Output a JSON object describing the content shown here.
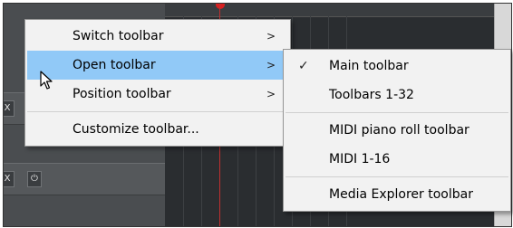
{
  "background": {
    "track_buttons": [
      {
        "icon": "close-icon",
        "glyph": "X"
      },
      {
        "icon": "power-icon",
        "glyph": "⏻"
      }
    ]
  },
  "main_menu": {
    "items": [
      {
        "label": "Switch toolbar",
        "has_submenu": true,
        "highlighted": false
      },
      {
        "label": "Open toolbar",
        "has_submenu": true,
        "highlighted": true
      },
      {
        "label": "Position toolbar",
        "has_submenu": true,
        "highlighted": false
      },
      {
        "separator": true
      },
      {
        "label": "Customize toolbar...",
        "has_submenu": false,
        "highlighted": false
      }
    ],
    "arrow_glyph": ">"
  },
  "sub_menu": {
    "items": [
      {
        "label": "Main toolbar",
        "checked": true
      },
      {
        "label": "Toolbars 1-32",
        "checked": false
      },
      {
        "separator": true
      },
      {
        "label": "MIDI piano roll toolbar",
        "checked": false
      },
      {
        "label": "MIDI 1-16",
        "checked": false
      },
      {
        "separator": true
      },
      {
        "label": "Media Explorer toolbar",
        "checked": false
      }
    ],
    "check_glyph": "✓"
  },
  "colors": {
    "menu_bg": "#f2f2f2",
    "highlight": "#91c9f7",
    "menu_border": "#979797"
  }
}
